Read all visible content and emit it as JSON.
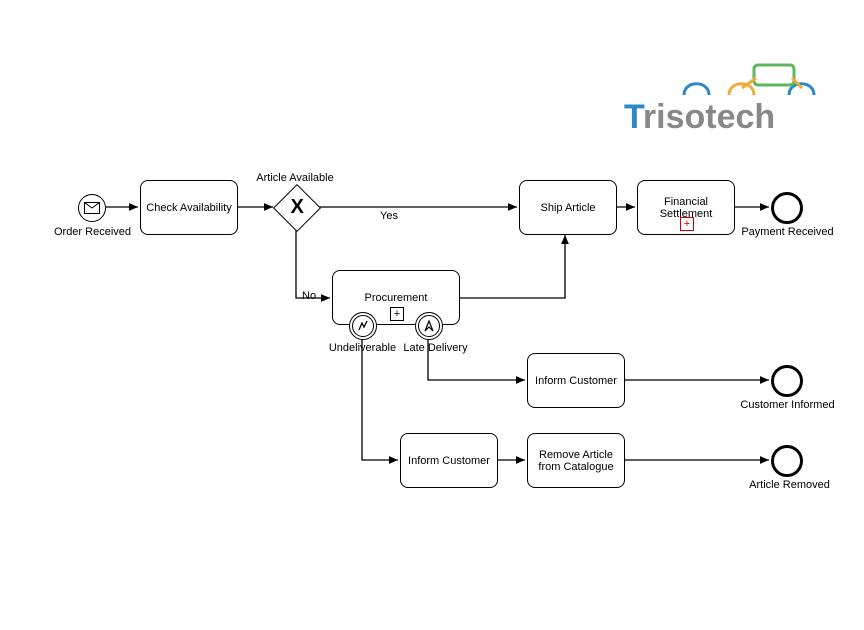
{
  "logo": {
    "text": "Trisotech"
  },
  "events": {
    "start": {
      "label": "Order Received"
    },
    "end_payment": {
      "label": "Payment Received"
    },
    "end_customer": {
      "label": "Customer Informed"
    },
    "end_article": {
      "label": "Article Removed"
    }
  },
  "tasks": {
    "check_availability": "Check Availability",
    "ship_article": "Ship Article",
    "financial_settlement": "Financial\nSettlement",
    "procurement": "Procurement",
    "inform_customer_1": "Inform Customer",
    "inform_customer_2": "Inform Customer",
    "remove_article": "Remove Article from Catalogue"
  },
  "gateway": {
    "label": "Article Available"
  },
  "flows": {
    "yes": "Yes",
    "no": "No"
  },
  "boundary": {
    "undeliverable": "Undeliverable",
    "late_delivery": "Late Delivery"
  }
}
